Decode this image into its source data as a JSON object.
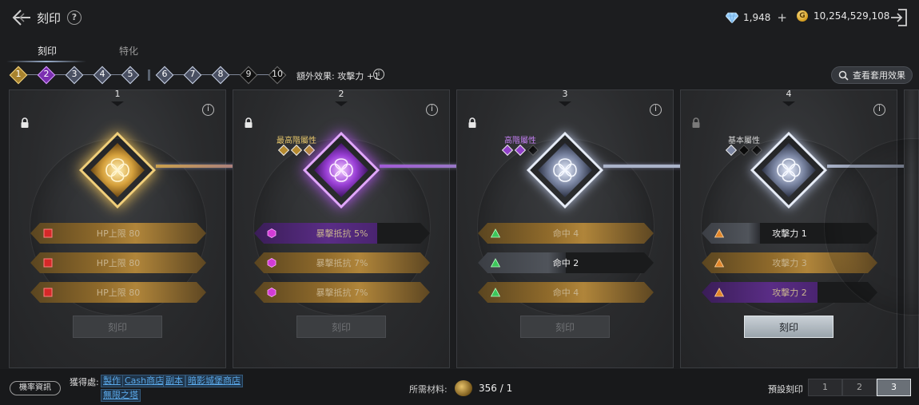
{
  "header": {
    "title": "刻印",
    "gems": "1,948",
    "gold": "10,254,529,108",
    "gold_symbol": "G"
  },
  "tabs": [
    {
      "label": "刻印",
      "active": true
    },
    {
      "label": "特化",
      "active": false
    }
  ],
  "levels": [
    {
      "label": "1",
      "style": "gold"
    },
    {
      "label": "2",
      "style": "purple"
    },
    {
      "label": "3",
      "style": "silver"
    },
    {
      "label": "4",
      "style": "silver"
    },
    {
      "label": "5",
      "style": "silver"
    },
    {
      "label": "6",
      "style": "silver"
    },
    {
      "label": "7",
      "style": "silver"
    },
    {
      "label": "8",
      "style": "silver"
    },
    {
      "label": "9",
      "style": "dark"
    },
    {
      "label": "10",
      "style": "dark"
    }
  ],
  "bonus_effect": "額外效果: 攻擊力 +1",
  "view_set_label": "查看套用效果",
  "slots": [
    {
      "number": "1",
      "tier_label": "",
      "theme": "gold",
      "stats": [
        {
          "text": "HP上限 80",
          "icon": "square-red-icon",
          "fill": "gold",
          "fill_pct": 100,
          "bright": false
        },
        {
          "text": "HP上限 80",
          "icon": "square-red-icon",
          "fill": "gold",
          "fill_pct": 100,
          "bright": false
        },
        {
          "text": "HP上限 80",
          "icon": "square-red-icon",
          "fill": "gold",
          "fill_pct": 100,
          "bright": false
        }
      ],
      "button_label": "刻印",
      "button_enabled": false
    },
    {
      "number": "2",
      "tier_label": "最高階屬性",
      "tier_color": "#e6c66a",
      "tier_dias": [
        "gold",
        "gold",
        "gold"
      ],
      "theme": "purple",
      "stats": [
        {
          "text": "暴擊抵抗 5%",
          "icon": "hexagon-pink-icon",
          "fill": "purple",
          "fill_pct": 70,
          "bright": false
        },
        {
          "text": "暴擊抵抗 7%",
          "icon": "hexagon-pink-icon",
          "fill": "gold",
          "fill_pct": 100,
          "bright": false
        },
        {
          "text": "暴擊抵抗 7%",
          "icon": "hexagon-pink-icon",
          "fill": "gold",
          "fill_pct": 100,
          "bright": false
        }
      ],
      "button_label": "刻印",
      "button_enabled": false
    },
    {
      "number": "3",
      "tier_label": "高階屬性",
      "tier_color": "#c27ff0",
      "tier_dias": [
        "purple",
        "purple",
        "black"
      ],
      "theme": "silver",
      "stats": [
        {
          "text": "命中 4",
          "icon": "triangle-green-icon",
          "fill": "gold",
          "fill_pct": 100,
          "bright": false
        },
        {
          "text": "命中 2",
          "icon": "triangle-green-icon",
          "fill": "gray",
          "fill_pct": 50,
          "bright": true
        },
        {
          "text": "命中 4",
          "icon": "triangle-green-icon",
          "fill": "gold",
          "fill_pct": 100,
          "bright": false
        }
      ],
      "button_label": "刻印",
      "button_enabled": false
    },
    {
      "number": "4",
      "tier_label": "基本屬性",
      "tier_color": "#d8d8d8",
      "tier_dias": [
        "silver",
        "black",
        "black"
      ],
      "theme": "silver",
      "stats": [
        {
          "text": "攻擊力 1",
          "icon": "triangle-orange-icon",
          "fill": "gray",
          "fill_pct": 33,
          "bright": true
        },
        {
          "text": "攻擊力 3",
          "icon": "triangle-orange-icon",
          "fill": "gold",
          "fill_pct": 100,
          "bright": false
        },
        {
          "text": "攻擊力 2",
          "icon": "triangle-orange-icon",
          "fill": "purple",
          "fill_pct": 66,
          "bright": false
        }
      ],
      "button_label": "刻印",
      "button_enabled": true
    }
  ],
  "footer": {
    "prob_label": "機率資訊",
    "obtain_label": "獲得處:",
    "obtain_links": [
      "製作",
      "Cash商店",
      "副本",
      "暗影城堡商店",
      "無限之塔"
    ],
    "material_label": "所需材料:",
    "material_count": "356 / 1",
    "preset_label": "預設刻印",
    "presets": [
      {
        "label": "1",
        "active": false
      },
      {
        "label": "2",
        "active": false
      },
      {
        "label": "3",
        "active": true
      }
    ]
  },
  "colors": {
    "gold": "#d9b05a",
    "purple": "#b45ef0",
    "silver": "#c8d2e8",
    "accent_link": "#5aa8e8"
  }
}
